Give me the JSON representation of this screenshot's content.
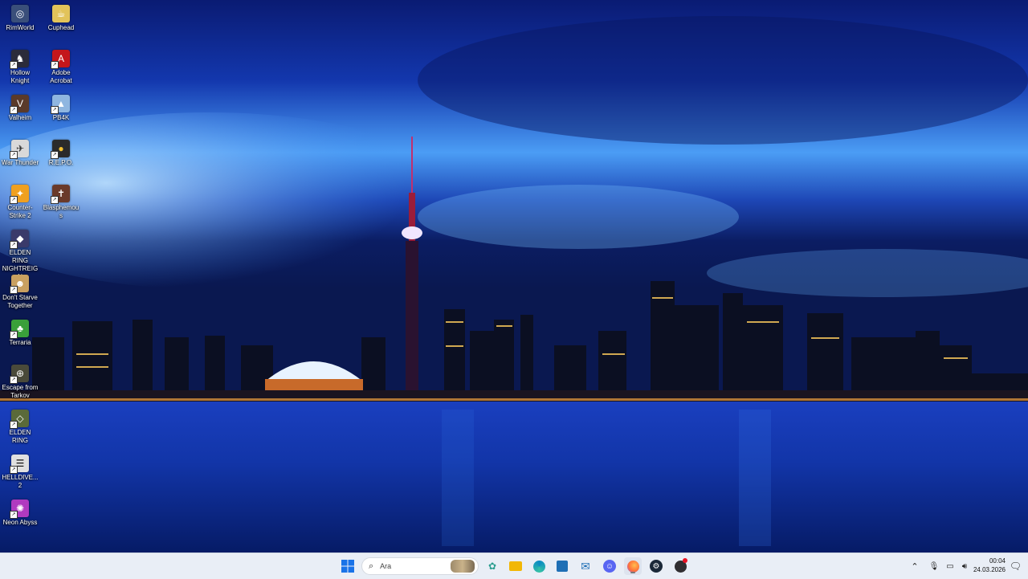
{
  "desktop_icons": [
    {
      "label": "RimWorld",
      "icon": "rimworld-icon",
      "color": "#3a4f7a",
      "glyph": "◎"
    },
    {
      "label": "Cuphead",
      "icon": "cuphead-icon",
      "color": "#e2c35a",
      "glyph": "☕"
    },
    {
      "label": "Hollow Knight",
      "icon": "hollow-knight-icon",
      "color": "#2b2b3a",
      "glyph": "♞"
    },
    {
      "label": "Adobe Acrobat",
      "icon": "acrobat-icon",
      "color": "#c4161c",
      "glyph": "A"
    },
    {
      "label": "Valheim",
      "icon": "valheim-icon",
      "color": "#5a3a2a",
      "glyph": "V"
    },
    {
      "label": "PB4K",
      "icon": "pb4k-icon",
      "color": "#8fb6e0",
      "glyph": "▲"
    },
    {
      "label": "War Thunder",
      "icon": "war-thunder-icon",
      "color": "#d9d9d9",
      "glyph": "✈"
    },
    {
      "label": "R.E.P.O.",
      "icon": "repo-icon",
      "color": "#2a2a2a",
      "glyph": "●"
    },
    {
      "label": "Counter-Strike 2",
      "icon": "counter-strike-icon",
      "color": "#f0a020",
      "glyph": "✦"
    },
    {
      "label": "Blasphemous",
      "icon": "blasphemous-icon",
      "color": "#6a3a2a",
      "glyph": "✝"
    },
    {
      "label": "ELDEN RING NIGHTREIGN",
      "icon": "elden-ring-nightreign-icon",
      "color": "#3a3a6a",
      "glyph": "◆"
    },
    {
      "label": "Don't Starve Together",
      "icon": "dont-starve-icon",
      "color": "#c9a060",
      "glyph": "☻"
    },
    {
      "label": "Terraria",
      "icon": "terraria-icon",
      "color": "#3aa03a",
      "glyph": "♣"
    },
    {
      "label": "Escape from Tarkov",
      "icon": "tarkov-icon",
      "color": "#4a4a3a",
      "glyph": "⊕"
    },
    {
      "label": "ELDEN RING",
      "icon": "elden-ring-icon",
      "color": "#5a6a3a",
      "glyph": "◇"
    },
    {
      "label": "HELLDIVE... 2",
      "icon": "helldivers-icon",
      "color": "#e0e0e0",
      "glyph": "☰"
    },
    {
      "label": "Neon Abyss",
      "icon": "neon-abyss-icon",
      "color": "#b03ac0",
      "glyph": "✺"
    }
  ],
  "taskbar": {
    "search_placeholder": "Ara",
    "apps": [
      {
        "name": "start-icon",
        "glyph": "⊞",
        "color": "#1a73e8"
      },
      {
        "name": "copilot-icon",
        "glyph": "✿",
        "color": "#2a9d8f"
      },
      {
        "name": "file-explorer-icon",
        "glyph": "▬",
        "color": "#f2b705"
      },
      {
        "name": "edge-icon",
        "glyph": "◐",
        "color": "#0a8ac4"
      },
      {
        "name": "store-icon",
        "glyph": "▣",
        "color": "#1f6fb5"
      },
      {
        "name": "outlook-icon",
        "glyph": "✉",
        "color": "#1f6fb5"
      },
      {
        "name": "discord-icon",
        "glyph": "☺",
        "color": "#5865f2"
      },
      {
        "name": "firefox-icon",
        "glyph": "●",
        "color": "#ff7139"
      },
      {
        "name": "steam-icon",
        "glyph": "⚙",
        "color": "#1b2838"
      },
      {
        "name": "obs-icon",
        "glyph": "◉",
        "color": "#302e31"
      }
    ],
    "tray": {
      "chevron": "chevron-up-icon",
      "mic": "microphone-icon",
      "network": "network-icon",
      "volume": "volume-icon",
      "notifications": "notification-icon"
    },
    "time": "00:04",
    "date": "24.03.2026"
  }
}
